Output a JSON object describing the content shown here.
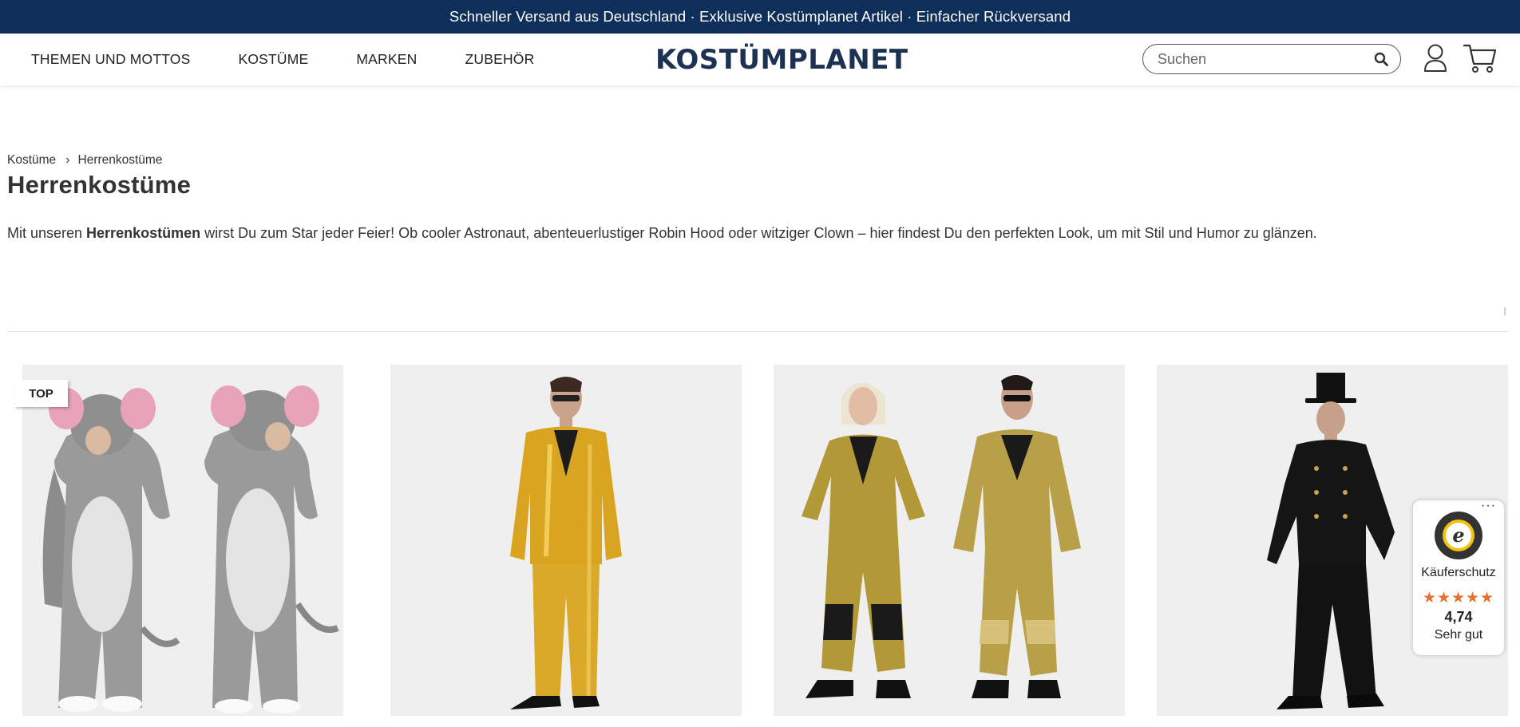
{
  "promo": {
    "item1": "Schneller Versand aus Deutschland",
    "sep1": " · ",
    "item2": "Exklusive Kostümplanet Artikel",
    "sep2": " · ",
    "item3": "Einfacher Rückversand",
    "color": "#0e2f5a"
  },
  "nav": {
    "themes": "THEMEN UND MOTTOS",
    "costumes": "KOSTÜME",
    "brands": "MARKEN",
    "accessories": "ZUBEHÖR"
  },
  "logo": "KOSTÜMPLANET",
  "search": {
    "placeholder": "Suchen",
    "value": ""
  },
  "breadcrumb": {
    "root": "Kostüme",
    "current": "Herrenkostüme"
  },
  "page": {
    "title": "Herrenkostüme",
    "intro_before": "Mit unseren ",
    "intro_bold": "Herrenkostümen",
    "intro_after": " wirst Du zum Star jeder Feier! Ob cooler Astronaut, abenteuerlustiger Robin Hood oder witziger Clown – hier findest Du den perfekten Look, um mit Stil und Humor zu glänzen."
  },
  "products": [
    {
      "badge": "TOP",
      "image": "grey-elephant-costume-image"
    },
    {
      "image": "gold-sequin-suit-image"
    },
    {
      "image": "gold-tracksuit-couple-image"
    },
    {
      "image": "chimney-sweep-costume-image"
    }
  ],
  "trusted_shops": {
    "more": "···",
    "seal_text": "TRUSTED SHOPS GUARANTEE",
    "label": "Käuferschutz",
    "stars": "★★★★★",
    "rating": 4.74,
    "rating_text": "4,74",
    "grade": "Sehr gut",
    "star_color": "#e5712d"
  }
}
